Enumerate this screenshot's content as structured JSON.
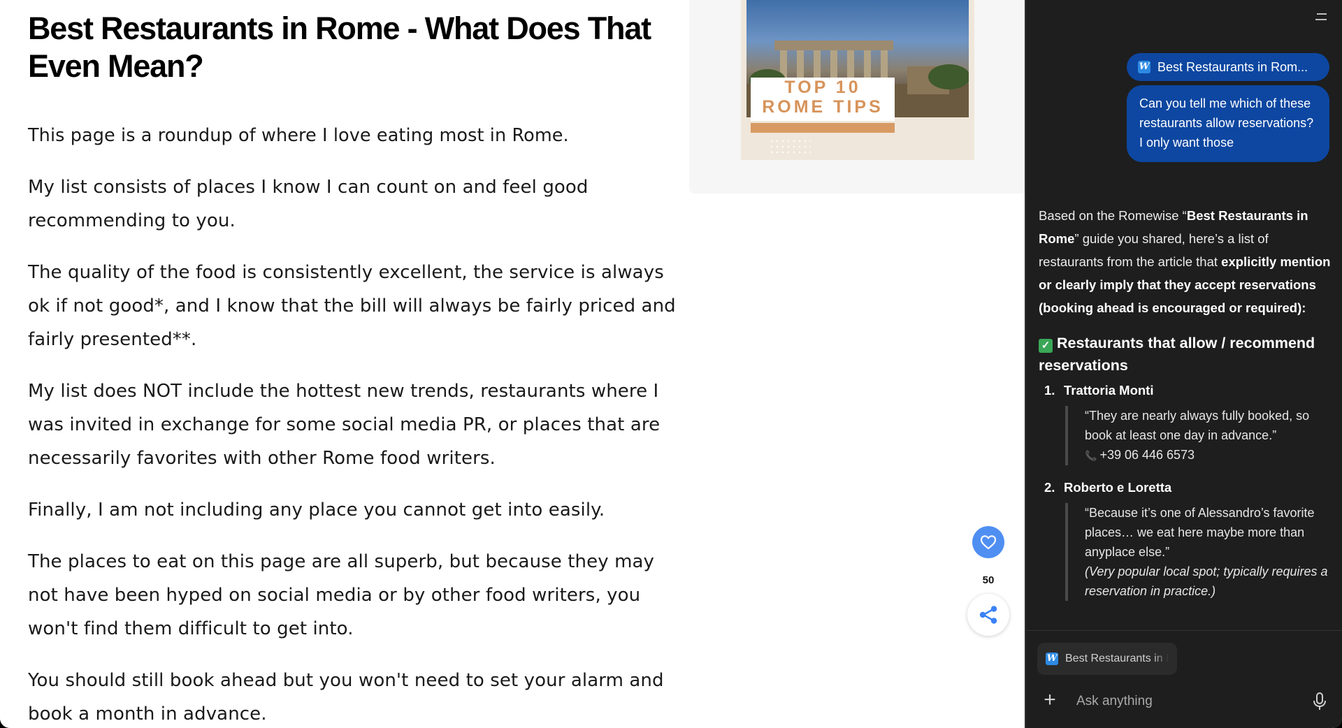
{
  "article": {
    "title": "Best Restaurants in Rome - What Does That Even Mean?",
    "paragraphs": [
      "This page is a roundup of where I love eating most in Rome.",
      "My list consists of places I know I can count on and feel good recommending to you.",
      "The quality of the food is consistently excellent, the service is always ok if not good*, and I know that the bill will always be fairly priced and fairly presented**.",
      "My list does NOT include the hottest new trends, restaurants where I was invited in exchange for some social media PR, or places that are necessarily favorites with other Rome food writers.",
      "Finally, I am not including any place you cannot get into easily.",
      "The places to eat on this page are all superb, but because they may not have been hyped on social media or by other food writers, you won't find them difficult to get into.",
      "You should still book ahead but you won't need to set your alarm and book a month in advance."
    ],
    "promo_image": {
      "line1": "TOP 10",
      "line2": "ROME TIPS"
    },
    "like_count": "50",
    "icons": {
      "like": "heart-icon",
      "share": "share-icon"
    },
    "colors": {
      "like_button": "#4f8ff2",
      "promo_text": "#d7935a"
    }
  },
  "chat": {
    "source_chip": "Best Restaurants in Rom...",
    "user_message": "Can you tell me which of these restaurants allow reservations? I only want those",
    "answer": {
      "intro_1": "Based on the Romewise “",
      "intro_2": "Best Restaurants in Rome",
      "intro_3": "” guide you shared, here’s a list of restaurants from the article that ",
      "intro_4": "explicitly mention or clearly imply that they accept reservations (booking ahead is encouraged or required):",
      "section_heading": "Restaurants that allow / recommend reservations",
      "restaurants": [
        {
          "number": "1.",
          "name": "Trattoria Monti",
          "quote": "“They are nearly always fully booked, so book at least one day in advance.”",
          "phone": "+39 06 446 6573"
        },
        {
          "number": "2.",
          "name": "Roberto e Loretta",
          "quote": "“Because it’s one of Alessandro’s favorite places… we eat here maybe more than anyplace else.”",
          "note": "(Very popular local spot; typically requires a reservation in practice.)"
        }
      ]
    },
    "attachment_chip": "Best Restaurants in Rome",
    "composer": {
      "placeholder": "Ask anything"
    },
    "icons": {
      "source": "w-logo-icon",
      "check": "check-icon",
      "plus": "plus-icon",
      "mic": "microphone-icon",
      "menu": "menu-icon"
    },
    "colors": {
      "panel_bg": "#1e1e1e",
      "bubble_bg": "#0d47a1"
    }
  }
}
